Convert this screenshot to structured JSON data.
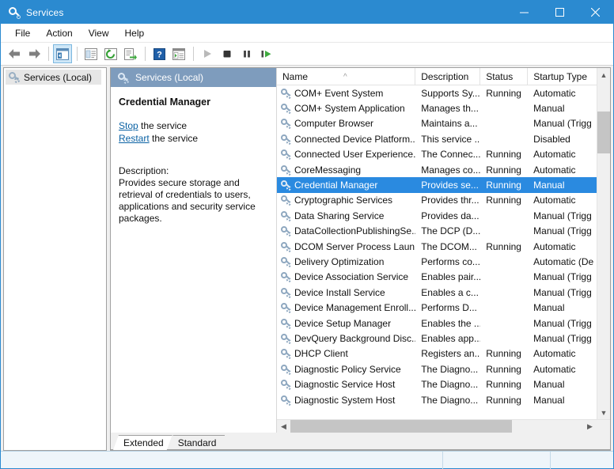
{
  "window": {
    "title": "Services",
    "icon": "services-gear-icon",
    "controls": {
      "minimize": "minimize-icon",
      "maximize": "maximize-icon",
      "close": "close-icon"
    },
    "accent_color": "#2b8ad0",
    "selection_color": "#2a8ae0"
  },
  "menubar": {
    "items": [
      {
        "label": "File"
      },
      {
        "label": "Action"
      },
      {
        "label": "View"
      },
      {
        "label": "Help"
      }
    ]
  },
  "toolbar": {
    "buttons": [
      {
        "name": "back-icon",
        "type": "arrow-left"
      },
      {
        "name": "forward-icon",
        "type": "arrow-right"
      },
      {
        "name": "show-hide-console-tree-icon",
        "type": "tree",
        "active": true
      },
      {
        "name": "properties-icon",
        "type": "properties"
      },
      {
        "name": "refresh-icon",
        "type": "refresh"
      },
      {
        "name": "export-list-icon",
        "type": "export"
      },
      {
        "name": "help-icon",
        "type": "help"
      },
      {
        "name": "show-hide-action-pane-icon",
        "type": "actionpane"
      },
      {
        "name": "start-service-icon",
        "type": "play"
      },
      {
        "name": "stop-service-icon",
        "type": "stop"
      },
      {
        "name": "pause-service-icon",
        "type": "pause"
      },
      {
        "name": "restart-service-icon",
        "type": "restart"
      }
    ]
  },
  "tree": {
    "items": [
      {
        "label": "Services (Local)",
        "icon": "services-gear-icon",
        "selected": true
      }
    ]
  },
  "detail": {
    "header": "Services (Local)",
    "header_icon": "services-gear-icon",
    "service_name": "Credential Manager",
    "links": [
      {
        "action": "Stop",
        "suffix": " the service"
      },
      {
        "action": "Restart",
        "suffix": " the service"
      }
    ],
    "description_label": "Description:",
    "description": "Provides secure storage and retrieval of credentials to users, applications and security service packages."
  },
  "list": {
    "sort_column": "Name",
    "sort_direction": "ascending",
    "columns": [
      {
        "key": "name",
        "label": "Name",
        "width": 182
      },
      {
        "key": "description",
        "label": "Description",
        "width": 85
      },
      {
        "key": "status",
        "label": "Status",
        "width": 62
      },
      {
        "key": "startup",
        "label": "Startup Type",
        "width": 90
      }
    ],
    "rows": [
      {
        "name": "COM+ Event System",
        "description": "Supports Sy...",
        "status": "Running",
        "startup": "Automatic",
        "selected": false
      },
      {
        "name": "COM+ System Application",
        "description": "Manages th...",
        "status": "",
        "startup": "Manual",
        "selected": false
      },
      {
        "name": "Computer Browser",
        "description": "Maintains a...",
        "status": "",
        "startup": "Manual (Trigg",
        "selected": false
      },
      {
        "name": "Connected Device Platform...",
        "description": "This service ...",
        "status": "",
        "startup": "Disabled",
        "selected": false
      },
      {
        "name": "Connected User Experience...",
        "description": "The Connec...",
        "status": "Running",
        "startup": "Automatic",
        "selected": false
      },
      {
        "name": "CoreMessaging",
        "description": "Manages co...",
        "status": "Running",
        "startup": "Automatic",
        "selected": false
      },
      {
        "name": "Credential Manager",
        "description": "Provides se...",
        "status": "Running",
        "startup": "Manual",
        "selected": true
      },
      {
        "name": "Cryptographic Services",
        "description": "Provides thr...",
        "status": "Running",
        "startup": "Automatic",
        "selected": false
      },
      {
        "name": "Data Sharing Service",
        "description": "Provides da...",
        "status": "",
        "startup": "Manual (Trigg",
        "selected": false
      },
      {
        "name": "DataCollectionPublishingSe...",
        "description": "The DCP (D...",
        "status": "",
        "startup": "Manual (Trigg",
        "selected": false
      },
      {
        "name": "DCOM Server Process Laun...",
        "description": "The DCOM...",
        "status": "Running",
        "startup": "Automatic",
        "selected": false
      },
      {
        "name": "Delivery Optimization",
        "description": "Performs co...",
        "status": "",
        "startup": "Automatic (De",
        "selected": false
      },
      {
        "name": "Device Association Service",
        "description": "Enables pair...",
        "status": "",
        "startup": "Manual (Trigg",
        "selected": false
      },
      {
        "name": "Device Install Service",
        "description": "Enables a c...",
        "status": "",
        "startup": "Manual (Trigg",
        "selected": false
      },
      {
        "name": "Device Management Enroll...",
        "description": "Performs D...",
        "status": "",
        "startup": "Manual",
        "selected": false
      },
      {
        "name": "Device Setup Manager",
        "description": "Enables the ...",
        "status": "",
        "startup": "Manual (Trigg",
        "selected": false
      },
      {
        "name": "DevQuery Background Disc...",
        "description": "Enables app...",
        "status": "",
        "startup": "Manual (Trigg",
        "selected": false
      },
      {
        "name": "DHCP Client",
        "description": "Registers an...",
        "status": "Running",
        "startup": "Automatic",
        "selected": false
      },
      {
        "name": "Diagnostic Policy Service",
        "description": "The Diagno...",
        "status": "Running",
        "startup": "Automatic",
        "selected": false
      },
      {
        "name": "Diagnostic Service Host",
        "description": "The Diagno...",
        "status": "Running",
        "startup": "Manual",
        "selected": false
      },
      {
        "name": "Diagnostic System Host",
        "description": "The Diagno...",
        "status": "Running",
        "startup": "Manual",
        "selected": false
      }
    ]
  },
  "scrollbars": {
    "vertical": {
      "up_icon": "chevron-up-icon",
      "down_icon": "chevron-down-icon"
    },
    "horizontal": {
      "left_icon": "chevron-left-icon",
      "right_icon": "chevron-right-icon"
    }
  },
  "tabs": [
    {
      "label": "Extended",
      "active": true
    },
    {
      "label": "Standard",
      "active": false
    }
  ],
  "statusbar": {
    "left": "",
    "middle": "",
    "right": ""
  }
}
